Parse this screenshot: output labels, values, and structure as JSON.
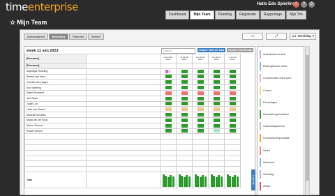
{
  "header": {
    "logo_a": "time",
    "logo_b": "enterprise",
    "hello": "Hallo Edo Spierling",
    "nav": [
      "Dashboard",
      "Mijn Team",
      "Planning",
      "Registratie",
      "Rapportage",
      "Mijn Tim"
    ],
    "active_nav": "Mijn Team"
  },
  "page": {
    "title": "Mijn Team"
  },
  "subtabs": [
    "Aanwezigheid",
    "Bezetting",
    "Patronen",
    "Beheer"
  ],
  "controls": {
    "weekday_label": "Weekdag"
  },
  "main": {
    "week_title": "week 11 van 2023",
    "filter_placeholder": "Zoeken",
    "btn_leave": "VRAAG VERLOF AAN",
    "btn_overtime": "VRAAG OVERW AAN",
    "group1": "[Personen]",
    "group2": "[Personen]",
    "days": [
      {
        "day": "ma 13-03",
        "year": "2023"
      },
      {
        "day": "di 14-03",
        "year": "2023"
      },
      {
        "day": "wo 15-03",
        "year": "2023"
      },
      {
        "day": "do 16-03",
        "year": "2023"
      },
      {
        "day": "vr 17-03",
        "year": "2023"
      }
    ],
    "rows": [
      {
        "name": "Angelique Roseling",
        "cells": [
          "a",
          "g",
          "g",
          "g",
          "g"
        ]
      },
      {
        "name": "Berend van Veen",
        "cells": [
          "g",
          "g",
          "g",
          "g",
          "g"
        ]
      },
      {
        "name": "Cornelis van Hagen",
        "cells": [
          "g",
          "g",
          "g",
          "g",
          "g"
        ]
      },
      {
        "name": "Edo Spierling",
        "cells": [
          "g",
          "g",
          "g",
          "g",
          "g"
        ]
      },
      {
        "name": "Egbert Broekhof",
        "cells": [
          "r",
          "r",
          "r",
          "r",
          "r"
        ]
      },
      {
        "name": "Jan Visser",
        "cells": [
          "g",
          "g",
          "g",
          "g",
          "g"
        ]
      },
      {
        "name": "Judith Lon",
        "cells": [
          "g",
          "g",
          "g",
          "g",
          "g"
        ]
      },
      {
        "name": "Lieke van Rossel",
        "cells": [
          "o",
          "o",
          "o",
          "o",
          "o"
        ]
      },
      {
        "name": "Mariette Hendriks",
        "cells": [
          "g",
          "g",
          "g",
          "g",
          "g"
        ]
      },
      {
        "name": "Marja van der Burg",
        "cells": [
          "g",
          "g",
          "g",
          "g",
          "g"
        ]
      },
      {
        "name": "Menno Romein",
        "cells": [
          "g",
          "g",
          "g",
          "g",
          "g"
        ]
      },
      {
        "name": "Rudolf Vriesen",
        "cells": [
          "g",
          "g",
          "g",
          "l",
          "g"
        ]
      }
    ],
    "total_label": "Total"
  },
  "legend": {
    "tab_label": "Legenda",
    "items": [
      {
        "label": "Arbeidsduurverkort",
        "color": "#c9a8e0"
      },
      {
        "label": "Buitengewoon verlof",
        "color": "#8ab4e8"
      },
      {
        "label": "Compensatie extra uren",
        "color": "#e8a8c8"
      },
      {
        "label": "Cursus",
        "color": "#e8e070"
      },
      {
        "label": "Feestdagen",
        "color": "#a0d8a0"
      },
      {
        "label": "Normaal ingeroosterd",
        "color": "#2c9a2c"
      },
      {
        "label": "Oudeschapsverlof",
        "color": "#c0c0c0"
      },
      {
        "label": "Overwerkcompensatie",
        "color": "#f5a623"
      },
      {
        "label": "Verlof",
        "color": "#f08080"
      },
      {
        "label": "Weekend",
        "color": "#8ab4e8"
      },
      {
        "label": "Werkdag",
        "color": "#c9a8e0"
      },
      {
        "label": "Ziekte",
        "color": "#e05050"
      }
    ]
  },
  "colors": {
    "green": "#2c9a2c",
    "red": "#f07070",
    "orange": "#f5c08a",
    "lightgreen": "#a8e8c8",
    "purple": "#c070d0"
  }
}
